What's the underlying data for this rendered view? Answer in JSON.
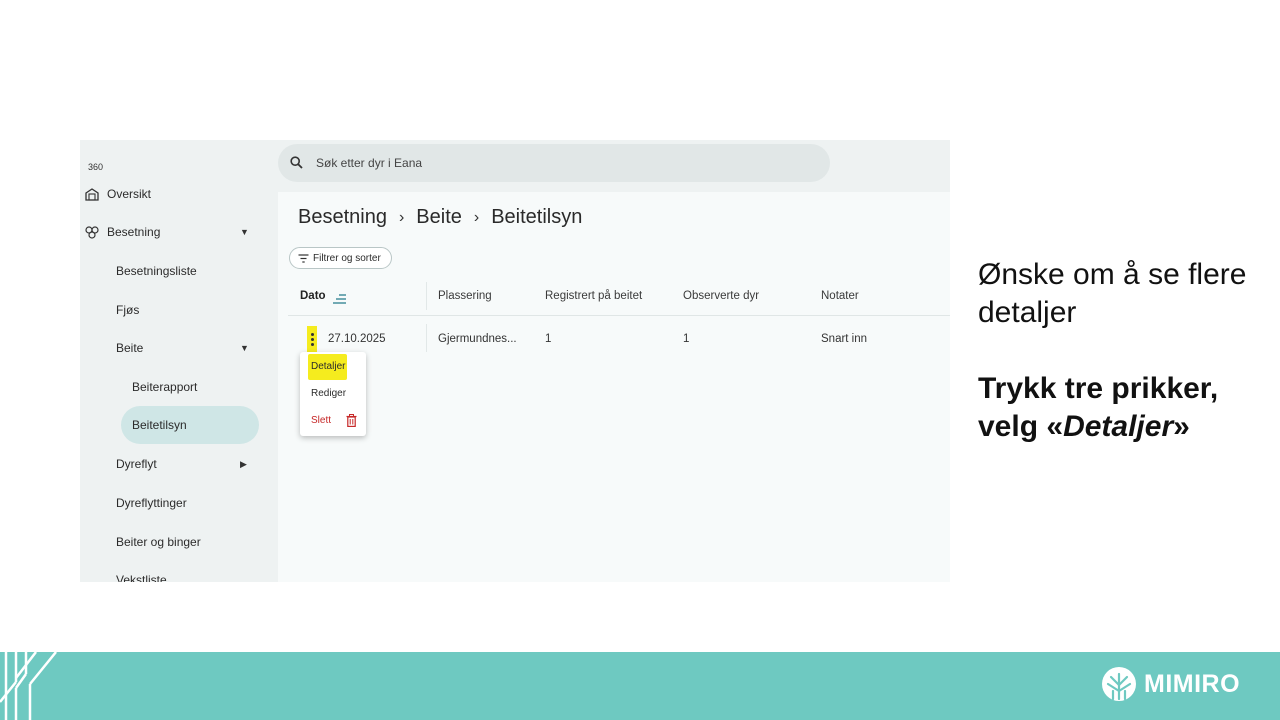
{
  "app": {
    "title": "360"
  },
  "sidebar": {
    "items": [
      {
        "label": "Oversikt",
        "icon": "barn-icon"
      },
      {
        "label": "Besetning",
        "icon": "herd-icon",
        "expanded": true
      },
      {
        "label": "Besetningsliste"
      },
      {
        "label": "Fjøs"
      },
      {
        "label": "Beite",
        "expanded": true
      },
      {
        "label": "Beiterapport"
      },
      {
        "label": "Beitetilsyn",
        "active": true
      },
      {
        "label": "Dyreflyt",
        "collapsed": true
      },
      {
        "label": "Dyreflyttinger"
      },
      {
        "label": "Beiter og binger"
      },
      {
        "label": "Vekstliste"
      }
    ],
    "active_color": "#cfe6e6"
  },
  "search": {
    "placeholder": "Søk etter dyr i Eana"
  },
  "breadcrumb": [
    "Besetning",
    "Beite",
    "Beitetilsyn"
  ],
  "filter_button": {
    "label": "Filtrer og sorter"
  },
  "table": {
    "headers": [
      "Dato",
      "Plassering",
      "Registrert på beitet",
      "Observerte dyr",
      "Notater"
    ],
    "rows": [
      {
        "dato": "27.10.2025",
        "plassering": "Gjermundnes...",
        "registrert": "1",
        "observerte": "1",
        "notater": "Snart inn"
      }
    ]
  },
  "context_menu": {
    "items": [
      {
        "label": "Detaljer",
        "highlighted": true
      },
      {
        "label": "Rediger"
      },
      {
        "label": "Slett",
        "danger": true,
        "icon": "trash-icon"
      }
    ]
  },
  "instructions": {
    "line1": "Ønske om å se flere detaljer",
    "line2_prefix": "Trykk tre prikker, velg «",
    "line2_emph": "Detaljer",
    "line2_suffix": "»"
  },
  "footer": {
    "brand": "MIMIRO",
    "color": "#6ec9c1"
  },
  "colors": {
    "highlight": "#f5ec1e",
    "danger": "#c62828"
  }
}
